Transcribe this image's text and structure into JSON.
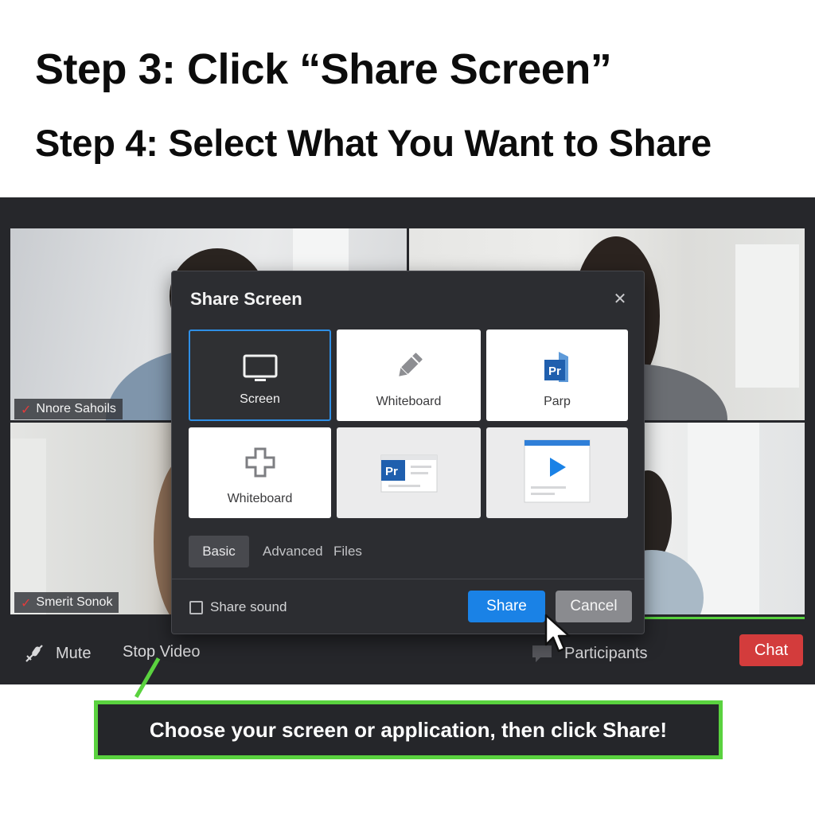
{
  "headings": {
    "step3": "Step 3: Click “Share Screen”",
    "step4": "Step 4: Select What You Want to Share"
  },
  "participants": [
    {
      "name": "Nnore Sahoils",
      "muted": true
    },
    {
      "name": "Smerit Sonok",
      "muted": true
    }
  ],
  "controls": {
    "mute": "Mute",
    "stop_video": "Stop Video",
    "participants": "Participants",
    "chat": "Chat"
  },
  "dialog": {
    "title": "Share Screen",
    "close_icon": "close-icon",
    "options": [
      {
        "label": "Screen",
        "icon": "monitor-icon",
        "selected": true
      },
      {
        "label": "Whiteboard",
        "icon": "pencil-icon",
        "selected": false
      },
      {
        "label": "Parp",
        "icon": "premiere-pro-icon",
        "selected": false
      },
      {
        "label": "Whiteboard",
        "icon": "plus-outline-icon",
        "selected": false
      },
      {
        "label": "",
        "icon": "premiere-window-icon",
        "selected": false
      },
      {
        "label": "",
        "icon": "video-player-window-icon",
        "selected": false
      }
    ],
    "tabs": [
      "Basic",
      "Advanced",
      "Files"
    ],
    "active_tab": "Basic",
    "share_sound_label": "Share sound",
    "share_sound_checked": false,
    "share_button": "Share",
    "cancel_button": "Cancel"
  },
  "callout": {
    "text": "Choose your screen or application, then click Share!"
  },
  "colors": {
    "accent_blue": "#1a82e6",
    "active_speaker_green": "#57d13e",
    "chat_red": "#d33c3c",
    "app_background": "#26272b"
  }
}
